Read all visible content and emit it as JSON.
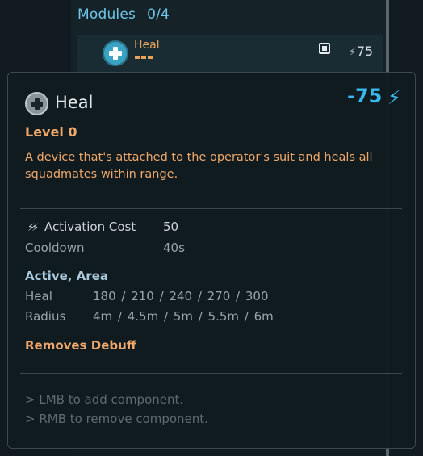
{
  "background": {
    "modules_label": "Modules",
    "modules_count": "0/4",
    "selected_row": {
      "name": "Heal",
      "cost": "75"
    }
  },
  "tooltip": {
    "title": "Heal",
    "energy_cost": "-75",
    "level": "Level 0",
    "description": "A device that's attached to the operator's suit and heals all squadmates within range.",
    "stats": [
      {
        "label": "Activation Cost",
        "value": "50"
      },
      {
        "label": "Cooldown",
        "value": "40s"
      }
    ],
    "active_section": {
      "heading": "Active, Area",
      "rows": [
        {
          "label": "Heal",
          "value": "180 / 210 / 240 / 270 / 300"
        },
        {
          "label": "Radius",
          "value": "4m / 4.5m / 5m / 5.5m / 6m"
        }
      ]
    },
    "effect": "Removes Debuff",
    "hints": [
      "> LMB to add component.",
      "> RMB to remove component."
    ]
  },
  "colors": {
    "accent_blue": "#38b8ee",
    "accent_orange": "#f0a86a"
  }
}
